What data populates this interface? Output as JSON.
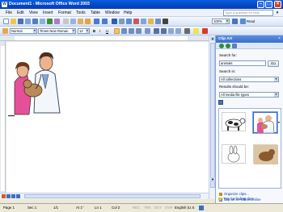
{
  "window": {
    "title": "Document1 - Microsoft Office Word 2003"
  },
  "menu": [
    "File",
    "Edit",
    "View",
    "Insert",
    "Format",
    "Tools",
    "Table",
    "Window",
    "Help"
  ],
  "help_box": {
    "placeholder": "Type a question for help"
  },
  "toolbar": {
    "zoom": "100%",
    "read_label": "Read",
    "style": "Normal",
    "font": "Times New Roman",
    "font_size": "12",
    "bold": "B",
    "italic": "I",
    "underline": "U"
  },
  "task_pane": {
    "title": "Clip Art",
    "search_for_label": "Search for:",
    "search_value": "animals",
    "go_label": "Go",
    "search_in_label": "Search in:",
    "search_in_value": "All collections",
    "results_label": "Results should be:",
    "results_value": "All media file types",
    "links": [
      "Organize clips...",
      "Clip art on Office Online",
      "Tips for finding clips"
    ]
  },
  "status_bar": {
    "page": "Page 1",
    "section": "Sec 1",
    "page_of": "1/1",
    "at": "At 1\"",
    "line": "Ln 1",
    "col": "Col 2",
    "modes": [
      "REC",
      "TRK",
      "EXT",
      "OVR"
    ],
    "language": "English (U.S"
  },
  "colors": {
    "titlebar": "#0546C8",
    "pane_header": "#3A6EC9",
    "link": "#0B3DA0"
  }
}
